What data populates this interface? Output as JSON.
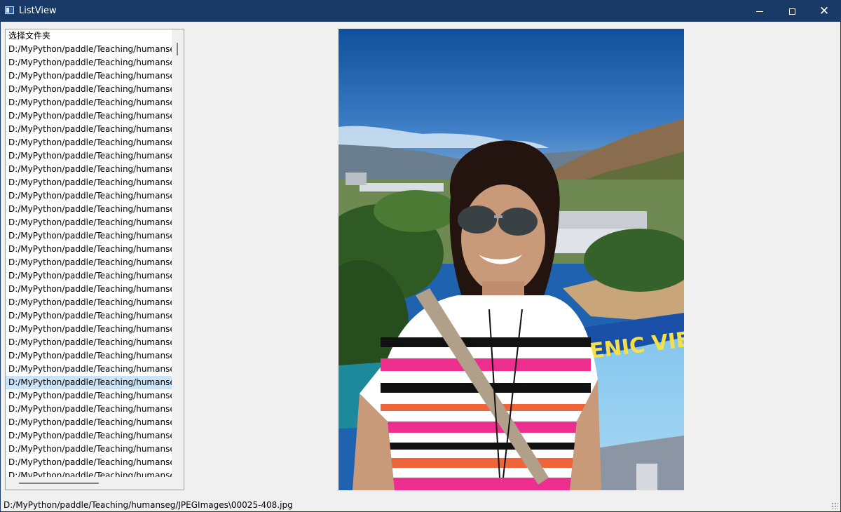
{
  "window": {
    "title": "ListView",
    "controls": {
      "minimize": "minimize",
      "maximize": "maximize",
      "close": "close"
    }
  },
  "list": {
    "items": [
      "选择文件夹",
      "D:/MyPython/paddle/Teaching/humanseg/JPEGImages/",
      "D:/MyPython/paddle/Teaching/humanseg/JPEGImages/",
      "D:/MyPython/paddle/Teaching/humanseg/JPEGImages/",
      "D:/MyPython/paddle/Teaching/humanseg/JPEGImages/",
      "D:/MyPython/paddle/Teaching/humanseg/JPEGImages/",
      "D:/MyPython/paddle/Teaching/humanseg/JPEGImages/",
      "D:/MyPython/paddle/Teaching/humanseg/JPEGImages/",
      "D:/MyPython/paddle/Teaching/humanseg/JPEGImages/",
      "D:/MyPython/paddle/Teaching/humanseg/JPEGImages/",
      "D:/MyPython/paddle/Teaching/humanseg/JPEGImages/",
      "D:/MyPython/paddle/Teaching/humanseg/JPEGImages/",
      "D:/MyPython/paddle/Teaching/humanseg/JPEGImages/",
      "D:/MyPython/paddle/Teaching/humanseg/JPEGImages/",
      "D:/MyPython/paddle/Teaching/humanseg/JPEGImages/",
      "D:/MyPython/paddle/Teaching/humanseg/JPEGImages/",
      "D:/MyPython/paddle/Teaching/humanseg/JPEGImages/",
      "D:/MyPython/paddle/Teaching/humanseg/JPEGImages/",
      "D:/MyPython/paddle/Teaching/humanseg/JPEGImages/",
      "D:/MyPython/paddle/Teaching/humanseg/JPEGImages/",
      "D:/MyPython/paddle/Teaching/humanseg/JPEGImages/",
      "D:/MyPython/paddle/Teaching/humanseg/JPEGImages/",
      "D:/MyPython/paddle/Teaching/humanseg/JPEGImages/",
      "D:/MyPython/paddle/Teaching/humanseg/JPEGImages/",
      "D:/MyPython/paddle/Teaching/humanseg/JPEGImages/",
      "D:/MyPython/paddle/Teaching/humanseg/JPEGImages/",
      "D:/MyPython/paddle/Teaching/humanseg/JPEGImages/",
      "D:/MyPython/paddle/Teaching/humanseg/JPEGImages/",
      "D:/MyPython/paddle/Teaching/humanseg/JPEGImages/",
      "D:/MyPython/paddle/Teaching/humanseg/JPEGImages/",
      "D:/MyPython/paddle/Teaching/humanseg/JPEGImages/",
      "D:/MyPython/paddle/Teaching/humanseg/JPEGImages/",
      "D:/MyPython/paddle/Teaching/humanseg/JPEGImages/",
      "D:/MyPython/paddle/Teaching/humanseg/JPEGImages/",
      "D:/MyPython/paddle/Teaching/humanseg/JPEGImages/"
    ],
    "selected_index": 26
  },
  "preview": {
    "icon": "photo-of-woman-at-scenic-viewpoint",
    "sign_text": "ENIC VIE"
  },
  "status": {
    "text": "D:/MyPython/paddle/Teaching/humanseg/JPEGImages\\00025-408.jpg"
  },
  "colors": {
    "titlebar": "#193a67",
    "selection": "#cce4f7",
    "window_bg": "#f0f0f0"
  }
}
